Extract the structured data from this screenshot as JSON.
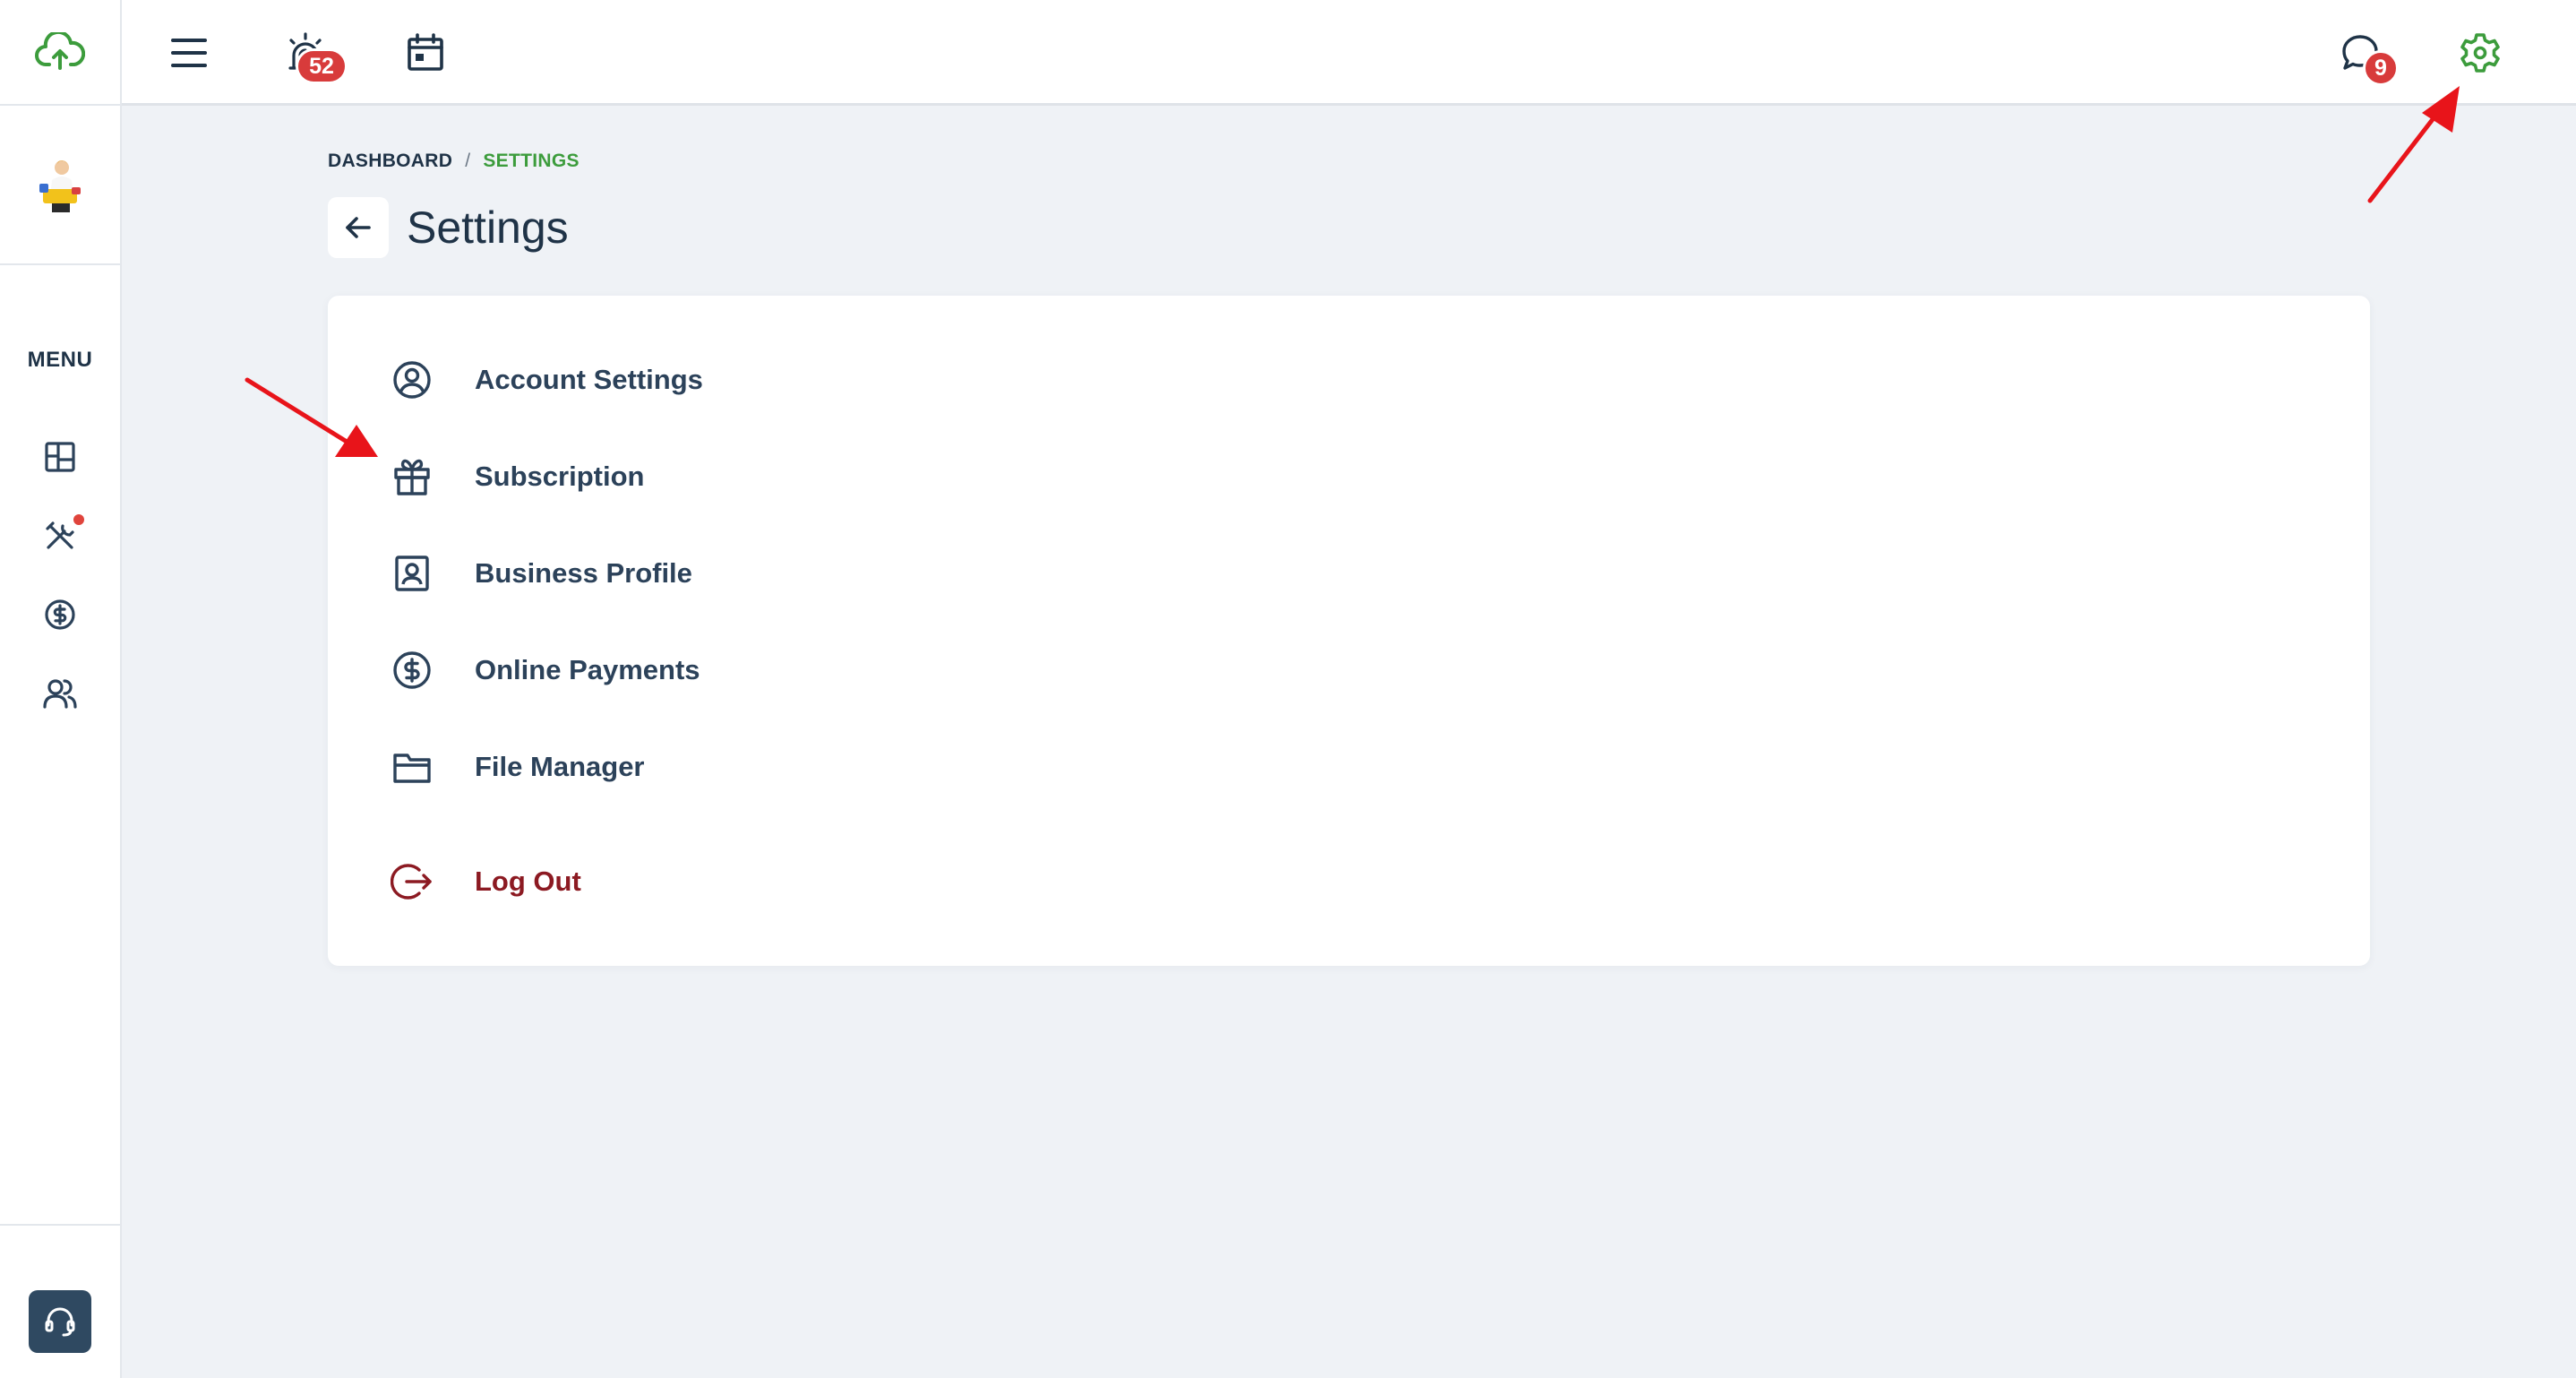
{
  "topbar": {
    "alerts_badge": "52",
    "messages_badge": "9"
  },
  "sidebar": {
    "menu_label": "MENU",
    "notification_dot_color": "#e0443c"
  },
  "breadcrumb": {
    "root": "DASHBOARD",
    "separator": "/",
    "current": "SETTINGS"
  },
  "page": {
    "title": "Settings"
  },
  "settings": {
    "items": [
      {
        "label": "Account Settings",
        "icon": "user-circle-icon"
      },
      {
        "label": "Subscription",
        "icon": "gift-icon"
      },
      {
        "label": "Business Profile",
        "icon": "id-badge-icon"
      },
      {
        "label": "Online Payments",
        "icon": "dollar-circle-icon"
      },
      {
        "label": "File Manager",
        "icon": "folder-icon"
      }
    ],
    "logout_label": "Log Out"
  },
  "colors": {
    "accent_green": "#3c9c3c",
    "badge_red": "#d83b3b",
    "logout_red": "#8c1a22",
    "annotation_arrow": "#e8141a",
    "support_button": "#2f4961"
  }
}
